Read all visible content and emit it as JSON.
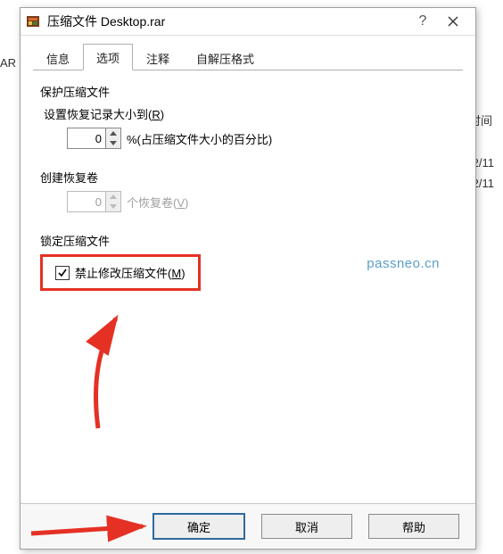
{
  "background": {
    "left_trunc": "AR 压",
    "col_time": "时间",
    "date1": "2/11",
    "date2": "2/11"
  },
  "titlebar": {
    "title": "压缩文件 Desktop.rar",
    "help": "?"
  },
  "tabs": {
    "info": "信息",
    "options": "选项",
    "comment": "注释",
    "sfx": "自解压格式"
  },
  "protect": {
    "group": "保护压缩文件",
    "set_recovery_label_pre": "设置恢复记录大小到(",
    "set_recovery_hot": "R",
    "set_recovery_label_post": ")",
    "value": "0",
    "percent_text": "%(占压缩文件大小的百分比)"
  },
  "volumes": {
    "group": "创建恢复卷",
    "value": "0",
    "suffix_pre": "个恢复卷(",
    "suffix_hot": "V",
    "suffix_post": ")"
  },
  "lock": {
    "group": "锁定压缩文件",
    "checked": true,
    "label_pre": "禁止修改压缩文件(",
    "label_hot": "M",
    "label_post": ")"
  },
  "watermark": "passneo.cn",
  "buttons": {
    "ok": "确定",
    "cancel": "取消",
    "help": "帮助"
  }
}
